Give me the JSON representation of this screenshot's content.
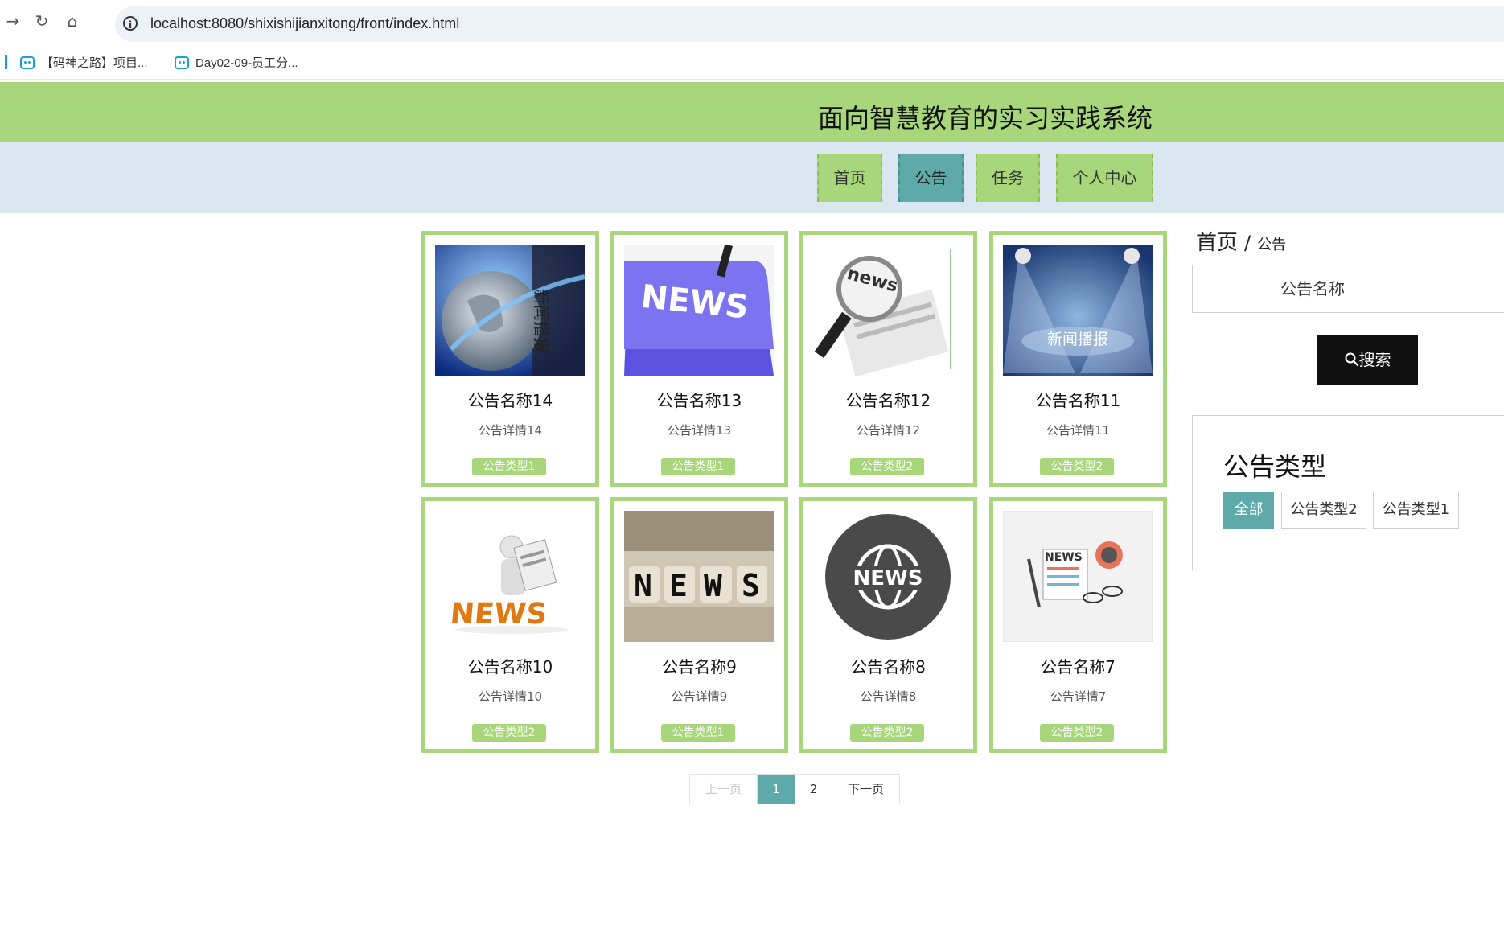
{
  "browser": {
    "url": "localhost:8080/shixishijianxitong/front/index.html",
    "bookmarks": [
      "【码神之路】项目...",
      "Day02-09-员工分..."
    ]
  },
  "site": {
    "title": "面向智慧教育的实习实践系统",
    "nav": [
      "首页",
      "公告",
      "任务",
      "个人中心"
    ],
    "active_nav": "公告"
  },
  "cards": [
    {
      "title": "公告名称14",
      "desc": "公告详情14",
      "tag": "公告类型1",
      "image": "globe-news"
    },
    {
      "title": "公告名称13",
      "desc": "公告详情13",
      "tag": "公告类型1",
      "image": "news-key"
    },
    {
      "title": "公告名称12",
      "desc": "公告详情12",
      "tag": "公告类型2",
      "image": "magnifier-news"
    },
    {
      "title": "公告名称11",
      "desc": "公告详情11",
      "tag": "公告类型2",
      "image": "spotlight-news",
      "image_text": "新闻播报"
    },
    {
      "title": "公告名称10",
      "desc": "公告详情10",
      "tag": "公告类型2",
      "image": "reader-news"
    },
    {
      "title": "公告名称9",
      "desc": "公告详情9",
      "tag": "公告类型1",
      "image": "dice-news"
    },
    {
      "title": "公告名称8",
      "desc": "公告详情8",
      "tag": "公告类型2",
      "image": "globe-badge-news"
    },
    {
      "title": "公告名称7",
      "desc": "公告详情7",
      "tag": "公告类型2",
      "image": "flat-news"
    }
  ],
  "pagination": {
    "prev": "上一页",
    "pages": [
      "1",
      "2"
    ],
    "current": "1",
    "next": "下一页"
  },
  "sidebar": {
    "breadcrumb_home": "首页",
    "breadcrumb_sep": "/",
    "breadcrumb_current": "公告",
    "search_placeholder": "公告名称",
    "search_button": "搜索",
    "category_title": "公告类型",
    "categories": [
      "全部",
      "公告类型2",
      "公告类型1"
    ],
    "active_category": "全部"
  },
  "colors": {
    "header_green": "#a8d67a",
    "nav_bg": "#dbe7f0",
    "active_teal": "#5ea9a9",
    "search_btn": "#111111"
  }
}
